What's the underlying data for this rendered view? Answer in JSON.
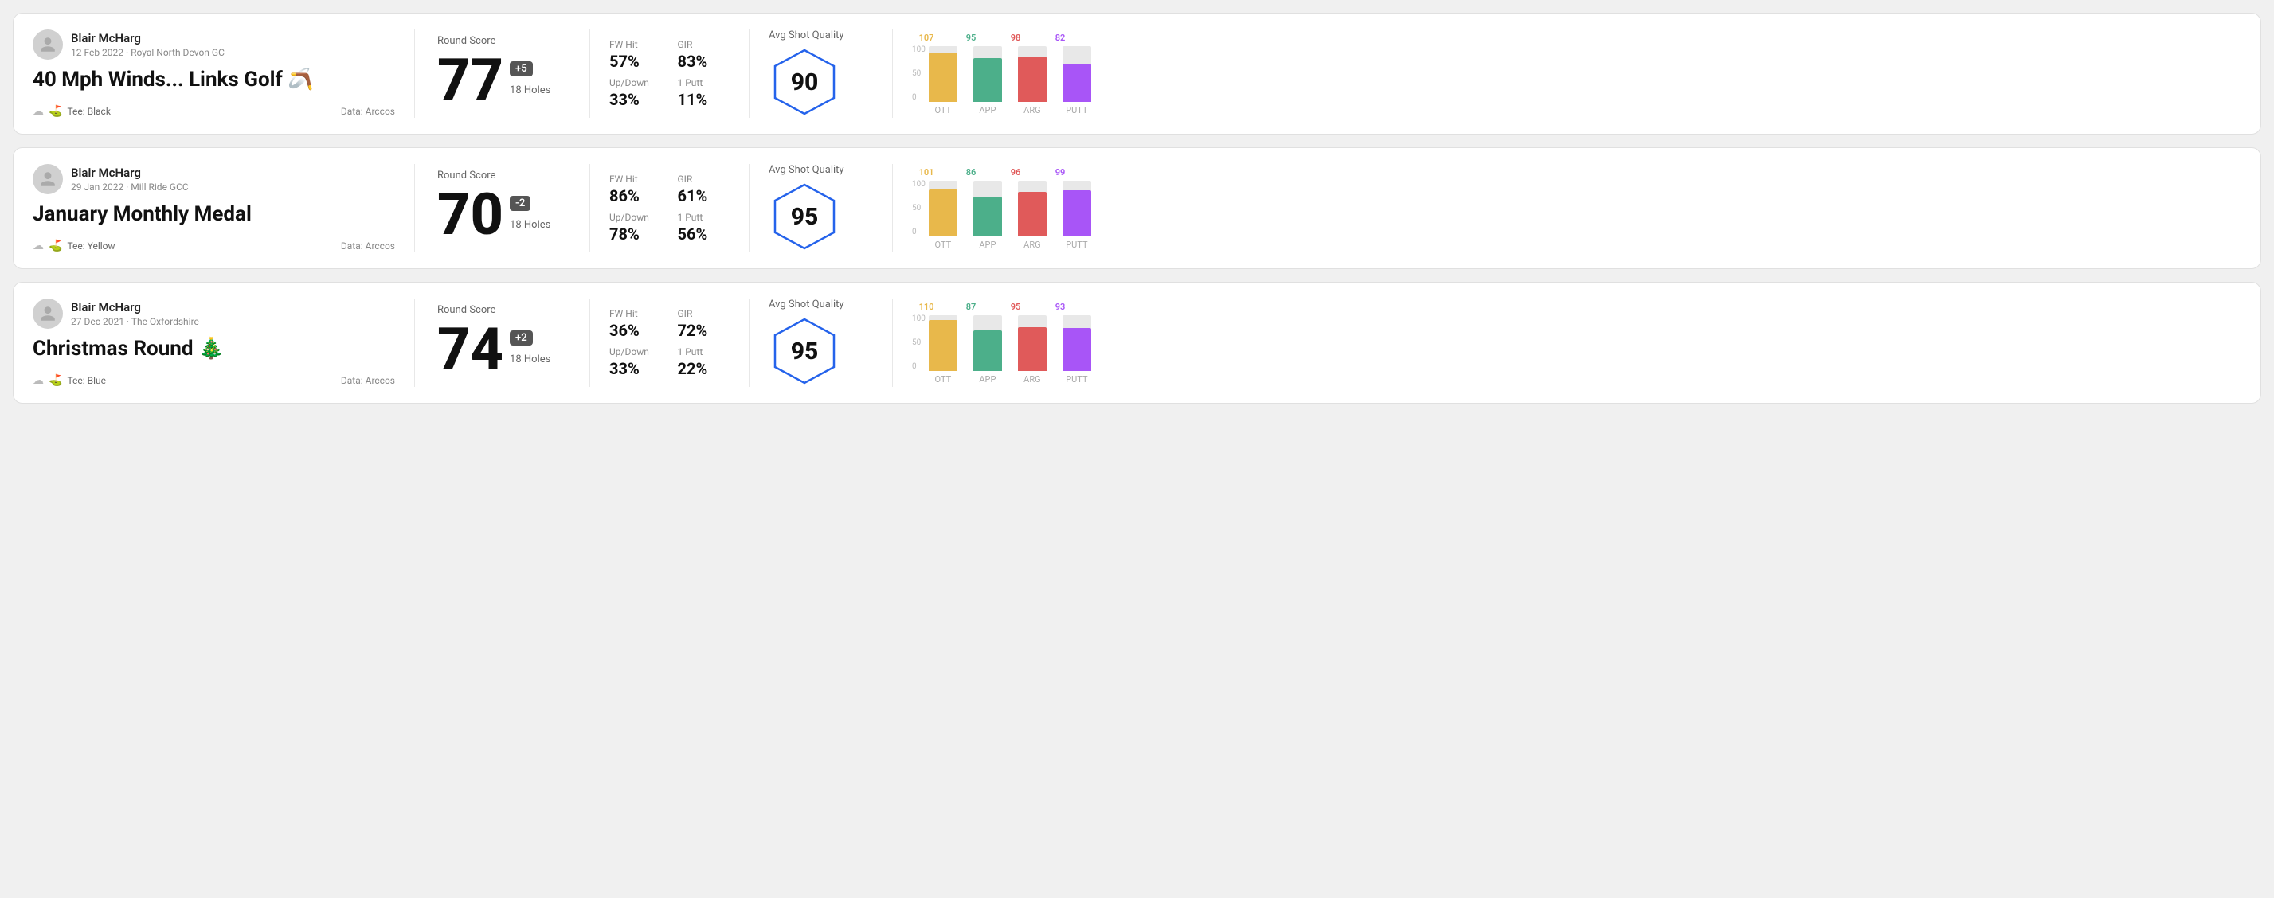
{
  "rounds": [
    {
      "id": "round1",
      "user": {
        "name": "Blair McHarg",
        "date": "12 Feb 2022",
        "course": "Royal North Devon GC"
      },
      "title": "40 Mph Winds... Links Golf 🪃",
      "tee": "Black",
      "data_source": "Data: Arccos",
      "score": "77",
      "score_diff": "+5",
      "holes": "18 Holes",
      "fw_hit": "57%",
      "gir": "83%",
      "up_down": "33%",
      "one_putt": "11%",
      "avg_shot_quality": "90",
      "chart": {
        "ott": {
          "value": 107,
          "color": "#e8b84b"
        },
        "app": {
          "value": 95,
          "color": "#4caf8a"
        },
        "arg": {
          "value": 98,
          "color": "#e05a5a"
        },
        "putt": {
          "value": 82,
          "color": "#a855f7"
        }
      }
    },
    {
      "id": "round2",
      "user": {
        "name": "Blair McHarg",
        "date": "29 Jan 2022",
        "course": "Mill Ride GCC"
      },
      "title": "January Monthly Medal",
      "tee": "Yellow",
      "data_source": "Data: Arccos",
      "score": "70",
      "score_diff": "-2",
      "holes": "18 Holes",
      "fw_hit": "86%",
      "gir": "61%",
      "up_down": "78%",
      "one_putt": "56%",
      "avg_shot_quality": "95",
      "chart": {
        "ott": {
          "value": 101,
          "color": "#e8b84b"
        },
        "app": {
          "value": 86,
          "color": "#4caf8a"
        },
        "arg": {
          "value": 96,
          "color": "#e05a5a"
        },
        "putt": {
          "value": 99,
          "color": "#a855f7"
        }
      }
    },
    {
      "id": "round3",
      "user": {
        "name": "Blair McHarg",
        "date": "27 Dec 2021",
        "course": "The Oxfordshire"
      },
      "title": "Christmas Round 🎄",
      "tee": "Blue",
      "data_source": "Data: Arccos",
      "score": "74",
      "score_diff": "+2",
      "holes": "18 Holes",
      "fw_hit": "36%",
      "gir": "72%",
      "up_down": "33%",
      "one_putt": "22%",
      "avg_shot_quality": "95",
      "chart": {
        "ott": {
          "value": 110,
          "color": "#e8b84b"
        },
        "app": {
          "value": 87,
          "color": "#4caf8a"
        },
        "arg": {
          "value": 95,
          "color": "#e05a5a"
        },
        "putt": {
          "value": 93,
          "color": "#a855f7"
        }
      }
    }
  ],
  "labels": {
    "round_score": "Round Score",
    "fw_hit": "FW Hit",
    "gir": "GIR",
    "up_down": "Up/Down",
    "one_putt": "1 Putt",
    "avg_shot_quality": "Avg Shot Quality",
    "ott": "OTT",
    "app": "APP",
    "arg": "ARG",
    "putt": "PUTT",
    "tee_prefix": "Tee:",
    "y_100": "100",
    "y_50": "50",
    "y_0": "0"
  }
}
